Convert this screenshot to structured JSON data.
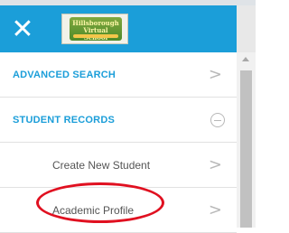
{
  "header": {
    "close_icon": "close-icon",
    "logo": {
      "line1": "Hillsborough",
      "line2": "Virtual School"
    }
  },
  "menu": {
    "advanced_search": {
      "label": "ADVANCED SEARCH",
      "icon": "chevron-right-icon"
    },
    "student_records": {
      "label": "STUDENT RECORDS",
      "icon": "collapse-minus-icon"
    },
    "create_new_student": {
      "label": "Create New Student",
      "icon": "chevron-right-icon"
    },
    "academic_profile": {
      "label": "Academic Profile",
      "icon": "chevron-right-icon"
    }
  },
  "colors": {
    "header_bg": "#1b9ed9",
    "section_text": "#1b9ed9",
    "annotation": "#e01020"
  }
}
